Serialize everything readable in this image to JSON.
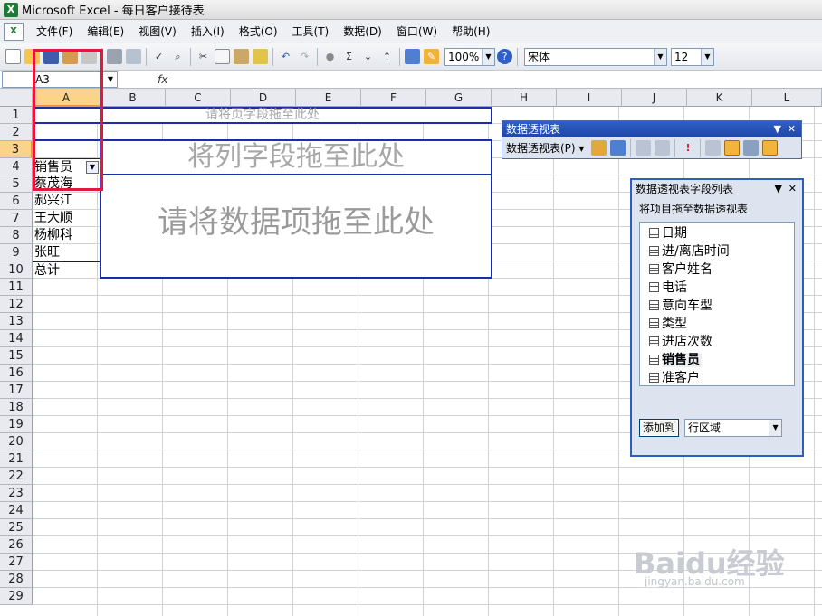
{
  "app": {
    "title": "Microsoft Excel - 每日客户接待表"
  },
  "menu": [
    "文件(F)",
    "编辑(E)",
    "视图(V)",
    "插入(I)",
    "格式(O)",
    "工具(T)",
    "数据(D)",
    "窗口(W)",
    "帮助(H)"
  ],
  "toolbar": {
    "zoom": "100%",
    "font": "宋体",
    "size": "12"
  },
  "formula": {
    "name_box": "A3",
    "fx": "fx"
  },
  "columns": [
    "A",
    "B",
    "C",
    "D",
    "E",
    "F",
    "G",
    "H",
    "I",
    "J",
    "K",
    "L"
  ],
  "rows": [
    "1",
    "2",
    "3",
    "4",
    "5",
    "6",
    "7",
    "8",
    "9",
    "10",
    "11",
    "12",
    "13",
    "14",
    "15",
    "16",
    "17",
    "18",
    "19",
    "20",
    "21",
    "22",
    "23",
    "24",
    "25",
    "26",
    "27",
    "28",
    "29"
  ],
  "selected": {
    "column": "A",
    "row": "3"
  },
  "pivot": {
    "page_drop": "请将页字段拖至此处",
    "column_drop": "将列字段拖至此处",
    "data_drop": "请将数据项拖至此处",
    "row_header": "销售员",
    "row_items": [
      "蔡茂海",
      "郝兴江",
      "王大顺",
      "杨柳科",
      "张旺"
    ],
    "total": "总计"
  },
  "pivot_toolbar": {
    "title": "数据透视表",
    "menu": "数据透视表(P)"
  },
  "field_list": {
    "title": "数据透视表字段列表",
    "subtitle": "将项目拖至数据透视表",
    "fields": [
      "日期",
      "进/离店时间",
      "客户姓名",
      "电话",
      "意向车型",
      "类型",
      "进店次数",
      "销售员",
      "准客户"
    ],
    "add_button": "添加到",
    "area_value": "行区域"
  },
  "watermark": {
    "brand": "Baidu经验",
    "url": "jingyan.baidu.com"
  },
  "colors": {
    "selected_header": "#fbd48a",
    "pivot_border": "#1a2ea8",
    "highlight": "#e5173c",
    "panel_title": "#1f47a8"
  }
}
